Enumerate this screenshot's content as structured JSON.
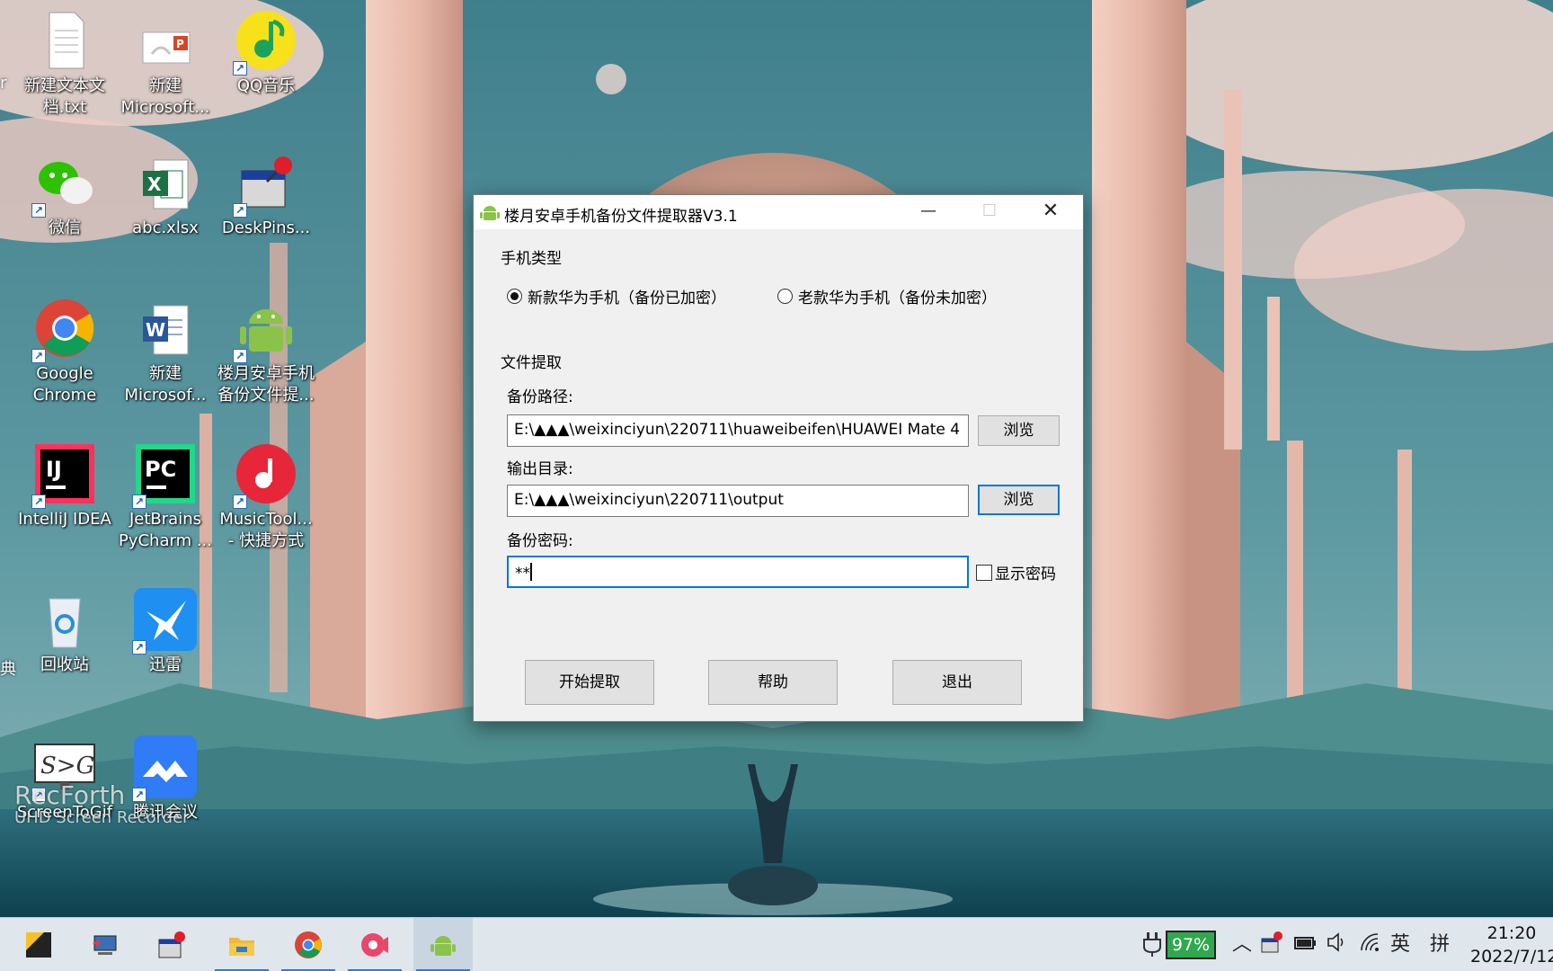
{
  "desktop": {
    "icons": [
      {
        "label": "新建文本文\n档.txt"
      },
      {
        "label": "新建\nMicrosoft..."
      },
      {
        "label": "QQ音乐"
      },
      {
        "label": "微信"
      },
      {
        "label": "abc.xlsx"
      },
      {
        "label": "DeskPins..."
      },
      {
        "label": "Google\nChrome"
      },
      {
        "label": "新建\nMicrosof..."
      },
      {
        "label": "楼月安卓手机\n备份文件提..."
      },
      {
        "label": "IntelliJ IDEA"
      },
      {
        "label": "JetBrains\nPyCharm ..."
      },
      {
        "label": "MusicTool...\n- 快捷方式"
      },
      {
        "label": "回收站"
      },
      {
        "label": "迅雷"
      },
      {
        "label": "ScreenToGif"
      },
      {
        "label": "腾讯会议"
      }
    ],
    "edge_left_1": "r",
    "edge_left_2": "典"
  },
  "dialog": {
    "title": "楼月安卓手机备份文件提取器V3.1",
    "phone_type_heading": "手机类型",
    "radio_new": "新款华为手机（备份已加密）",
    "radio_old": "老款华为手机（备份未加密）",
    "radio_selected": "new",
    "file_extract_heading": "文件提取",
    "backup_path_label": "备份路径:",
    "backup_path_value": "E:\\▲▲▲\\weixinciyun\\220711\\huaweibeifen\\HUAWEI Mate 4",
    "browse_label": "浏览",
    "output_dir_label": "输出目录:",
    "output_dir_value": "E:\\▲▲▲\\weixinciyun\\220711\\output",
    "password_label": "备份密码:",
    "password_value": "**",
    "show_password_label": "显示密码",
    "show_password_checked": false,
    "start_button": "开始提取",
    "help_button": "帮助",
    "exit_button": "退出"
  },
  "watermark": {
    "line1": "RecForth",
    "line2": "UHD Screen Recorder"
  },
  "taskbar": {
    "apps": [
      "sticky-notes",
      "network-tool",
      "deskpins",
      "file-explorer",
      "chrome",
      "screen-recorder",
      "android-extractor"
    ],
    "battery_percent": "97%",
    "ime_language": "英",
    "ime_mode": "拼",
    "time": "21:20",
    "date": "2022/7/12"
  },
  "colors": {
    "accent": "#0078d7",
    "battery": "#2fa84f"
  }
}
